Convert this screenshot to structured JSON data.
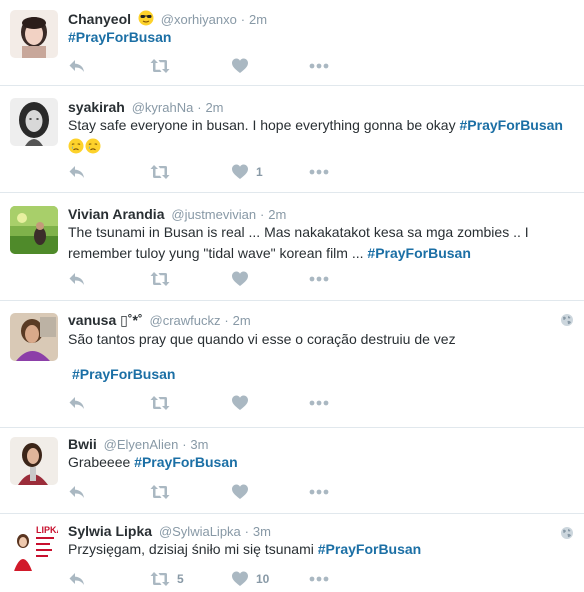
{
  "tweets": [
    {
      "name": "Chanyeol",
      "name_emoji": "sunglasses-face",
      "handle": "@xorhiyanxo",
      "separator": "·",
      "time": "2m",
      "text": "",
      "hashtag": "#PrayForBusan",
      "retweet_count": "",
      "like_count": "",
      "globe": false
    },
    {
      "name": "syakirah",
      "handle": "@kyrahNa",
      "separator": "·",
      "time": "2m",
      "text": "Stay safe everyone in busan. I hope everything gonna be okay ",
      "hashtag": "#PrayForBusan",
      "trailing_emoji": [
        "crying-face",
        "crying-face"
      ],
      "retweet_count": "",
      "like_count": "1",
      "globe": false
    },
    {
      "name": "Vivian Arandia",
      "handle": "@justmevivian",
      "separator": "·",
      "time": "2m",
      "text": "The tsunami in Busan is real ... Mas nakakatakot kesa sa mga zombies .. I remember tuloy yung \"tidal wave\" korean film ... ",
      "hashtag": "#PrayForBusan",
      "retweet_count": "",
      "like_count": "",
      "globe": false
    },
    {
      "name": "vanusa ▯˚*˚",
      "handle": "@crawfuckz",
      "separator": "·",
      "time": "2m",
      "text": "São tantos pray que quando vi esse o coração destruiu de vez",
      "hashtag": "#PrayForBusan",
      "retweet_count": "",
      "like_count": "",
      "globe": true
    },
    {
      "name": "Bwii",
      "handle": "@ElyenAlien",
      "separator": "·",
      "time": "3m",
      "text": "Grabeeee ",
      "hashtag": "#PrayForBusan",
      "retweet_count": "",
      "like_count": "",
      "globe": false
    },
    {
      "name": "Sylwia Lipka",
      "handle": "@SylwiaLipka",
      "separator": "·",
      "time": "3m",
      "text": "Przysięgam, dzisiaj śniło mi się tsunami ",
      "hashtag": "#PrayForBusan",
      "retweet_count": "5",
      "like_count": "10",
      "globe": true
    }
  ],
  "avatar_text": {
    "sylwia": "LIPKA"
  },
  "colors": {
    "hashtag": "#1b6fa5",
    "muted": "#8899a6",
    "icon": "#aab8c2",
    "text": "#292f33",
    "divider": "#e1e8ed"
  },
  "icons": {
    "reply": "reply-icon",
    "retweet": "retweet-icon",
    "like": "heart-icon",
    "more": "more-dots-icon",
    "globe": "globe-icon"
  }
}
